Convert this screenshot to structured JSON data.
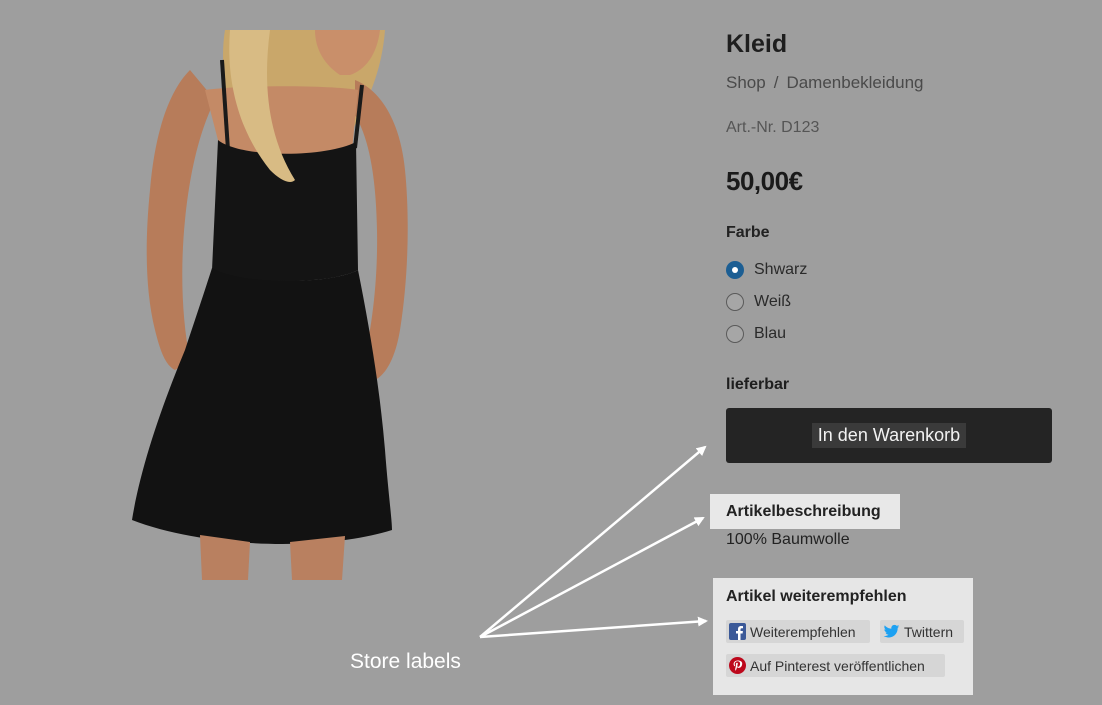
{
  "product": {
    "title": "Kleid",
    "breadcrumb": [
      "Shop",
      "Damenbekleidung"
    ],
    "breadcrumb_separator": "/",
    "sku": "Art.-Nr. D123",
    "price": "50,00€",
    "color_label": "Farbe",
    "colors": [
      {
        "label": "Shwarz",
        "selected": true
      },
      {
        "label": "Weiß",
        "selected": false
      },
      {
        "label": "Blau",
        "selected": false
      }
    ],
    "availability": "lieferbar",
    "add_to_cart_label": "In den Warenkorb",
    "description_title": "Artikelbeschreibung",
    "description_text": "100% Baumwolle",
    "share_title": "Artikel weiterempfehlen",
    "share_buttons": {
      "facebook": "Weiterempfehlen",
      "twitter": "Twittern",
      "pinterest": "Auf Pinterest veröffentlichen"
    }
  },
  "annotation": {
    "label": "Store labels"
  },
  "colors": {
    "overlay_background": "#9e9e9e",
    "button_dark": "#242424",
    "radio_selected": "#1c5e93",
    "highlight_box": "#e8e8e8",
    "facebook_blue": "#3b5998",
    "twitter_blue": "#1da1f2",
    "pinterest_red": "#bd081c"
  },
  "icons": [
    "facebook-icon",
    "twitter-icon",
    "pinterest-icon",
    "product-photo"
  ]
}
